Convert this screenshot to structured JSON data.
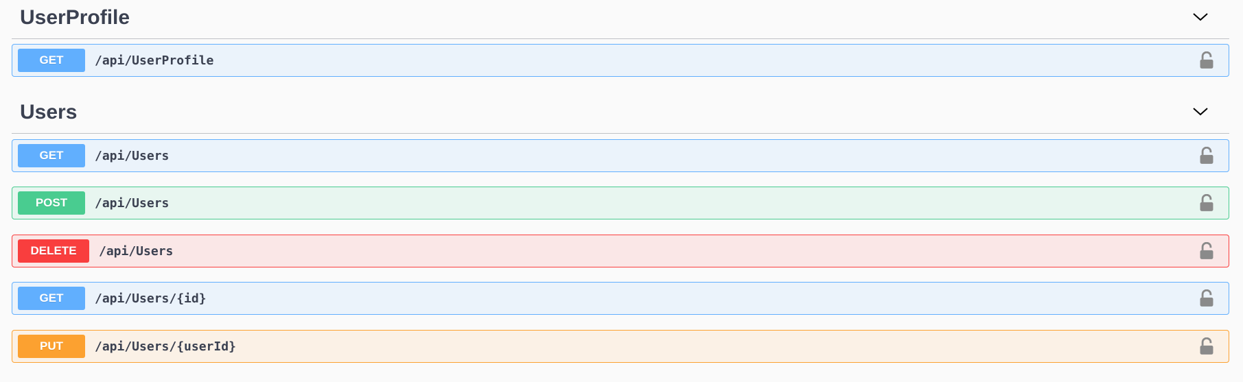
{
  "sections": [
    {
      "title": "UserProfile",
      "operations": [
        {
          "method": "GET",
          "path": "/api/UserProfile",
          "color": "#61affe"
        }
      ]
    },
    {
      "title": "Users",
      "operations": [
        {
          "method": "GET",
          "path": "/api/Users",
          "color": "#61affe"
        },
        {
          "method": "POST",
          "path": "/api/Users",
          "color": "#49cc90"
        },
        {
          "method": "DELETE",
          "path": "/api/Users",
          "color": "#f93e3e"
        },
        {
          "method": "GET",
          "path": "/api/Users/{id}",
          "color": "#61affe"
        },
        {
          "method": "PUT",
          "path": "/api/Users/{userId}",
          "color": "#fca130"
        }
      ]
    }
  ],
  "icons": {
    "collapse": "chevron-down-icon",
    "authorize": "lock-icon"
  }
}
